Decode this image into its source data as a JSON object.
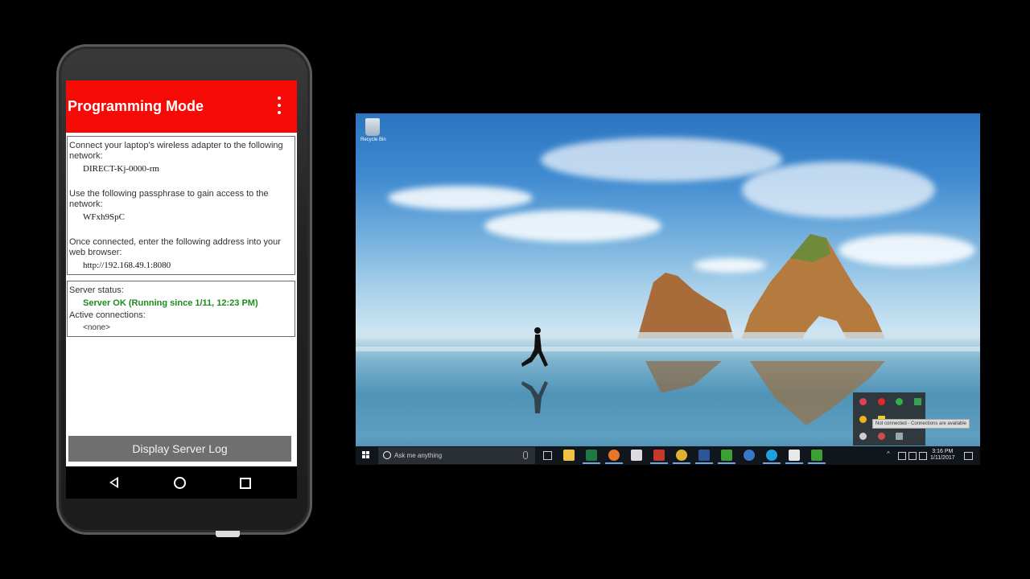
{
  "phone": {
    "app_title": "Programming Mode",
    "menu_icon": "overflow-menu-icon",
    "network_label": "Connect your laptop's wireless adapter to the following network:",
    "network_name": "DIRECT-Kj-0000-rm",
    "passphrase_label": "Use the following passphrase to gain access to the network:",
    "passphrase": "WFxh9SpC",
    "address_label": "Once connected, enter the following address into your web browser:",
    "address": "http://192.168.49.1:8080",
    "server_status_label": "Server status:",
    "server_status": "Server OK (Running since 1/11, 12:23 PM)",
    "active_connections_label": "Active connections:",
    "active_connections": "<none>",
    "log_button": "Display Server Log",
    "nav_icons": [
      "back-icon",
      "home-icon",
      "recents-icon"
    ],
    "colors": {
      "appbar": "#f60a06",
      "status_ok": "#1e8a1e",
      "button": "#6f6f6f"
    }
  },
  "desktop": {
    "recycle_bin_label": "Recycle Bin",
    "search_placeholder": "Ask me anything",
    "tooltip": "Not connected - Connections are available",
    "clock_time": "3:16 PM",
    "clock_date": "1/11/2017",
    "taskbar_apps": [
      "file-explorer-icon",
      "excel-icon",
      "firefox-icon",
      "store-icon",
      "powerpoint-icon",
      "chrome-icon",
      "word-icon",
      "app-green-icon",
      "app-blue-icon",
      "skype-icon",
      "acrobat-icon",
      "camtasia-icon"
    ]
  }
}
